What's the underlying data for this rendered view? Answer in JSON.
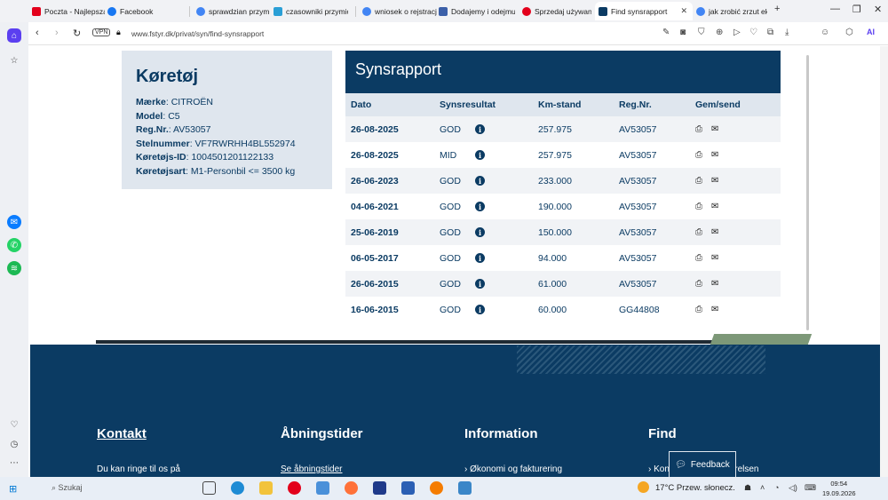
{
  "tabs": [
    {
      "label": "Poczta - Najlepsza",
      "color": "#e3001b"
    },
    {
      "label": "Facebook",
      "color": "#1877f2"
    },
    {
      "label": "sprawdzian przymio",
      "color": "#4285f4"
    },
    {
      "label": "czasowniki przymio",
      "color": "#2a9fd6"
    },
    {
      "label": "wniosek o rejstracje",
      "color": "#4285f4"
    },
    {
      "label": "Dodajemy i odejmu",
      "color": "#3b5fa8"
    },
    {
      "label": "Sprzedaj używane (",
      "color": "#e3001b"
    },
    {
      "label": "Find synsrapport",
      "color": "#0b3b63",
      "active": true
    },
    {
      "label": "jak zrobić zrzut ekr",
      "color": "#4285f4"
    }
  ],
  "addressbar": {
    "vpn": "VPN",
    "url": "www.fstyr.dk/privat/syn/find-synsrapport",
    "ai": "AI"
  },
  "vehicle": {
    "title": "Køretøj",
    "rows": [
      {
        "label": "Mærke",
        "value": "CITROËN"
      },
      {
        "label": "Model",
        "value": "C5"
      },
      {
        "label": "Reg.Nr.",
        "value": "AV53057"
      },
      {
        "label": "Stelnummer",
        "value": "VF7RWRHH4BL552974"
      },
      {
        "label": "Køretøjs-ID",
        "value": "1004501201122133"
      },
      {
        "label": "Køretøjsart",
        "value": "M1-Personbil <= 3500 kg"
      }
    ]
  },
  "rapport": {
    "title": "Synsrapport",
    "headers": {
      "dato": "Dato",
      "result": "Synsresultat",
      "km": "Km-stand",
      "reg": "Reg.Nr.",
      "gem": "Gem/send"
    },
    "rows": [
      {
        "dato": "26-08-2025",
        "result": "GOD",
        "km": "257.975",
        "reg": "AV53057"
      },
      {
        "dato": "26-08-2025",
        "result": "MID",
        "km": "257.975",
        "reg": "AV53057"
      },
      {
        "dato": "26-06-2023",
        "result": "GOD",
        "km": "233.000",
        "reg": "AV53057"
      },
      {
        "dato": "04-06-2021",
        "result": "GOD",
        "km": "190.000",
        "reg": "AV53057"
      },
      {
        "dato": "25-06-2019",
        "result": "GOD",
        "km": "150.000",
        "reg": "AV53057"
      },
      {
        "dato": "06-05-2017",
        "result": "GOD",
        "km": "94.000",
        "reg": "AV53057"
      },
      {
        "dato": "26-06-2015",
        "result": "GOD",
        "km": "61.000",
        "reg": "AV53057"
      },
      {
        "dato": "16-06-2015",
        "result": "GOD",
        "km": "60.000",
        "reg": "GG44808"
      }
    ]
  },
  "footer": {
    "kontakt": "Kontakt",
    "kontakt_text": "Du kan ringe til os på",
    "abning": "Åbningstider",
    "abning_link": "Se åbningstider",
    "info": "Information",
    "info_link": "Økonomi og fakturering",
    "find": "Find",
    "find_link": "Kontakt Færdselsstyrelsen",
    "feedback": "Feedback"
  },
  "taskbar": {
    "search": "Szukaj",
    "weather": "17°C  Przew. słonecz.",
    "time": "09:54",
    "date": "19.09.2026"
  }
}
